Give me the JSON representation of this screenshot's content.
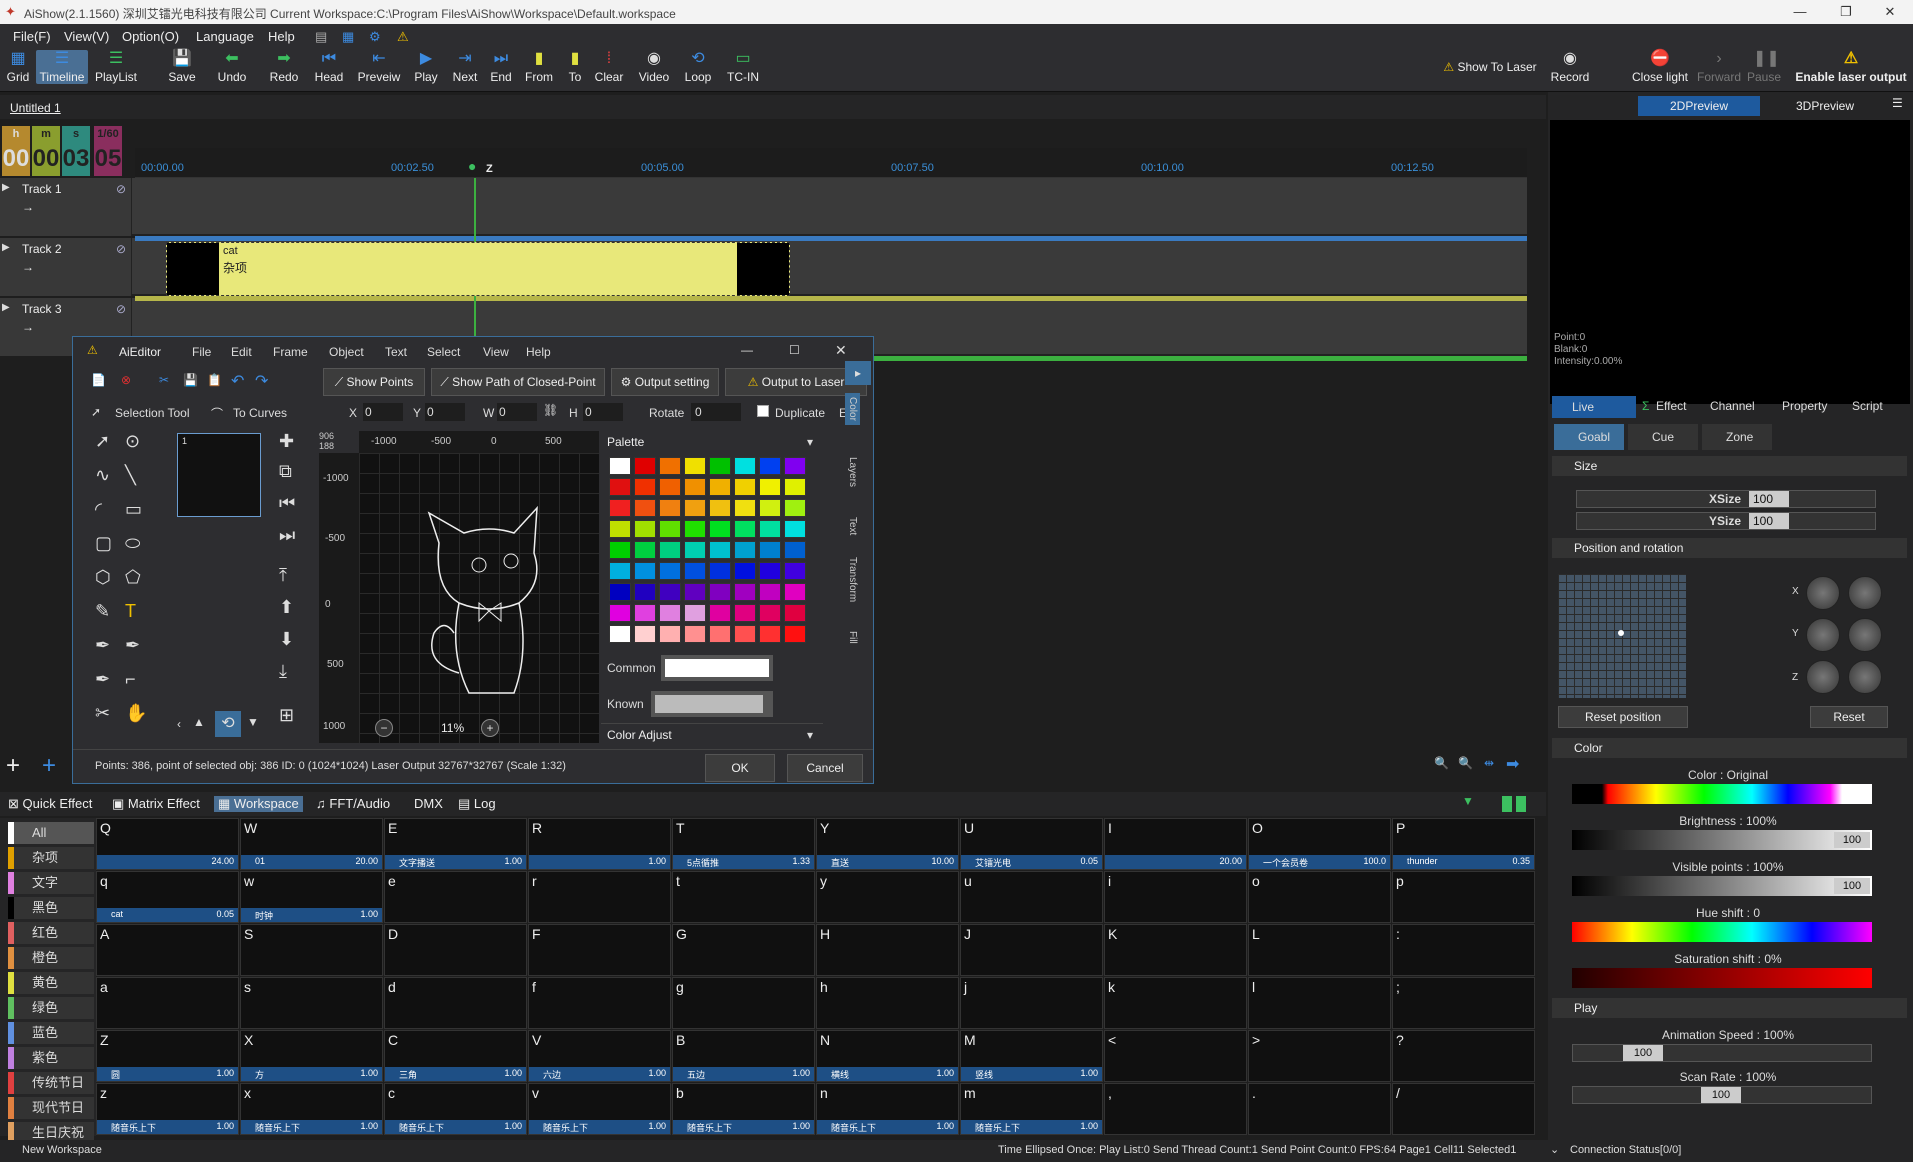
{
  "window": {
    "title": "AiShow(2.1.1560) 深圳艾镭光电科技有限公司 Current Workspace:C:\\Program Files\\AiShow\\Workspace\\Default.workspace"
  },
  "menu": [
    "File(F)",
    "View(V)",
    "Option(O)",
    "Language",
    "Help"
  ],
  "toolbar": [
    "Grid",
    "Timeline",
    "PlayList",
    "Save",
    "Undo",
    "Redo",
    "Head",
    "Preveiw",
    "Play",
    "Next",
    "End",
    "From",
    "To",
    "Clear",
    "Video",
    "Loop",
    "TC-IN"
  ],
  "show_to_laser": "Show To Laser",
  "right_toolbar": [
    "Record",
    "Close light",
    "Forward",
    "Pause",
    "Enable laser output"
  ],
  "preview_tabs": [
    "2DPreview",
    "3DPreview"
  ],
  "preview_info": [
    "Point:0",
    "Blank:0",
    "Intensity:0.00%"
  ],
  "doc_tab": "Untitled 1",
  "hms": [
    {
      "a": "h",
      "b": "00"
    },
    {
      "a": "m",
      "b": "00"
    },
    {
      "a": "s",
      "b": "03"
    },
    {
      "a": "1/60",
      "b": "05"
    }
  ],
  "ruler_ticks": [
    "00:00.00",
    "00:02.50",
    "00:05.00",
    "00:07.50",
    "00:10.00",
    "00:12.50"
  ],
  "playhead_label": "Z",
  "tracks": [
    "Track 1",
    "Track 2",
    "Track 3"
  ],
  "track_arrow": "→",
  "clip": {
    "name": "cat",
    "sub": "杂项"
  },
  "editor": {
    "title": "AiEditor",
    "menu": [
      "File",
      "Edit",
      "Frame",
      "Object",
      "Text",
      "Select",
      "View",
      "Help"
    ],
    "buttons": [
      "Show Points",
      "Show Path of Closed-Point",
      "Output setting",
      "Output to Laser"
    ],
    "tool_row": {
      "selection": "Selection Tool",
      "curves": "To Curves",
      "x_label": "X",
      "x_val": "0",
      "y_label": "Y",
      "y_val": "0",
      "w_label": "W",
      "w_val": "0",
      "h_label": "H",
      "h_val": "0",
      "rotate_label": "Rotate",
      "rotate_val": "0",
      "duplicate": "Duplicate",
      "exp": "Exp"
    },
    "coords": [
      "906",
      "188"
    ],
    "hruler": [
      "-1000",
      "-500",
      "0",
      "500"
    ],
    "vruler": [
      "-1000",
      "-500",
      "0",
      "500",
      "1000"
    ],
    "zoom": "11%",
    "frame_no": "1",
    "palette_title": "Palette",
    "common": "Common",
    "known": "Known",
    "color_adjust": "Color Adjust",
    "side_tabs": [
      "Color",
      "Layers",
      "Text",
      "Transform",
      "Fill"
    ],
    "status": "Points: 386, point of selected obj: 386 ID: 0 (1024*1024) Laser Output 32767*32767 (Scale 1:32)",
    "ok": "OK",
    "cancel": "Cancel"
  },
  "palette_colors": [
    [
      "#ffffff",
      "#e00000",
      "#f07000",
      "#f0e000",
      "#00c000",
      "#00e0e0",
      "#0040f0",
      "#8000f0"
    ],
    [
      "#e01010",
      "#f03000",
      "#f06000",
      "#f09000",
      "#f0b000",
      "#f0d000",
      "#f0f000",
      "#e0f000"
    ],
    [
      "#f02020",
      "#f05010",
      "#f08010",
      "#f0a010",
      "#f0c010",
      "#f0e010",
      "#d0f010",
      "#a0f010"
    ],
    [
      "#c0e000",
      "#a0e000",
      "#60e000",
      "#20e000",
      "#00e020",
      "#00e060",
      "#00e0a0",
      "#00e0e0"
    ],
    [
      "#00d000",
      "#00d040",
      "#00d080",
      "#00d0b0",
      "#00c0d0",
      "#00a0d0",
      "#0080d0",
      "#0060d0"
    ],
    [
      "#00b0e0",
      "#0090e0",
      "#0070e0",
      "#0050e0",
      "#0030e0",
      "#0010e0",
      "#2000e0",
      "#4000e0"
    ],
    [
      "#0000c0",
      "#2000c0",
      "#4000c0",
      "#6000c0",
      "#8000c0",
      "#a000c0",
      "#c000c0",
      "#e000c0"
    ],
    [
      "#e000e0",
      "#e040e0",
      "#e080e0",
      "#e0a0e0",
      "#e000a0",
      "#e00080",
      "#e00060",
      "#e00040"
    ],
    [
      "#ffffff",
      "#ffd0d0",
      "#ffb0b0",
      "#ff9090",
      "#ff7070",
      "#ff5050",
      "#ff3030",
      "#ff1010"
    ]
  ],
  "bottom_tabs": [
    "Quick Effect",
    "Matrix Effect",
    "Workspace",
    "FFT/Audio",
    "DMX",
    "Log"
  ],
  "categories": [
    {
      "label": "All",
      "color": "#ffffff"
    },
    {
      "label": "杂项",
      "color": "#e0a000"
    },
    {
      "label": "文字",
      "color": "#e080e0"
    },
    {
      "label": "黑色",
      "color": "#000000"
    },
    {
      "label": "红色",
      "color": "#e06060"
    },
    {
      "label": "橙色",
      "color": "#e09040"
    },
    {
      "label": "黄色",
      "color": "#e0e040"
    },
    {
      "label": "绿色",
      "color": "#60c060"
    },
    {
      "label": "蓝色",
      "color": "#6090e0"
    },
    {
      "label": "紫色",
      "color": "#c080e0"
    },
    {
      "label": "传统节日",
      "color": "#e04040"
    },
    {
      "label": "现代节日",
      "color": "#e08040"
    },
    {
      "label": "生日庆祝",
      "color": "#e0a060"
    }
  ],
  "grid_rows": [
    [
      {
        "k": "Q",
        "n": "",
        "v": "24.00"
      },
      {
        "k": "W",
        "n": "01",
        "v": "20.00"
      },
      {
        "k": "E",
        "n": "文字播送",
        "v": "1.00"
      },
      {
        "k": "R",
        "n": "",
        "v": "1.00"
      },
      {
        "k": "T",
        "n": "5点循推",
        "v": "1.33"
      },
      {
        "k": "Y",
        "n": "直送",
        "v": "10.00"
      },
      {
        "k": "U",
        "n": "艾镭光电",
        "v": "0.05"
      },
      {
        "k": "I",
        "n": "",
        "v": "20.00"
      },
      {
        "k": "O",
        "n": "一个会员卷",
        "v": "100.0"
      },
      {
        "k": "P",
        "n": "thunder",
        "v": "0.35"
      }
    ],
    [
      {
        "k": "q",
        "n": "cat",
        "v": "0.05"
      },
      {
        "k": "w",
        "n": "时钟",
        "v": "1.00"
      },
      {
        "k": "e"
      },
      {
        "k": "r"
      },
      {
        "k": "t"
      },
      {
        "k": "y"
      },
      {
        "k": "u"
      },
      {
        "k": "i"
      },
      {
        "k": "o"
      },
      {
        "k": "p"
      }
    ],
    [
      {
        "k": "A"
      },
      {
        "k": "S"
      },
      {
        "k": "D"
      },
      {
        "k": "F"
      },
      {
        "k": "G"
      },
      {
        "k": "H"
      },
      {
        "k": "J"
      },
      {
        "k": "K"
      },
      {
        "k": "L"
      },
      {
        "k": ":"
      }
    ],
    [
      {
        "k": "a"
      },
      {
        "k": "s"
      },
      {
        "k": "d"
      },
      {
        "k": "f"
      },
      {
        "k": "g"
      },
      {
        "k": "h"
      },
      {
        "k": "j"
      },
      {
        "k": "k"
      },
      {
        "k": "l"
      },
      {
        "k": ";"
      }
    ],
    [
      {
        "k": "Z",
        "n": "圆",
        "v": "1.00"
      },
      {
        "k": "X",
        "n": "方",
        "v": "1.00"
      },
      {
        "k": "C",
        "n": "三角",
        "v": "1.00"
      },
      {
        "k": "V",
        "n": "六边",
        "v": "1.00"
      },
      {
        "k": "B",
        "n": "五边",
        "v": "1.00"
      },
      {
        "k": "N",
        "n": "横线",
        "v": "1.00"
      },
      {
        "k": "M",
        "n": "竖线",
        "v": "1.00"
      },
      {
        "k": "<"
      },
      {
        "k": ">"
      },
      {
        "k": "?"
      }
    ],
    [
      {
        "k": "z",
        "n": "随音乐上下",
        "v": "1.00"
      },
      {
        "k": "x",
        "n": "随音乐上下",
        "v": "1.00"
      },
      {
        "k": "c",
        "n": "随音乐上下",
        "v": "1.00"
      },
      {
        "k": "v",
        "n": "随音乐上下",
        "v": "1.00"
      },
      {
        "k": "b",
        "n": "随音乐上下",
        "v": "1.00"
      },
      {
        "k": "n",
        "n": "随音乐上下",
        "v": "1.00"
      },
      {
        "k": "m",
        "n": "随音乐上下",
        "v": "1.00"
      },
      {
        "k": ","
      },
      {
        "k": "."
      },
      {
        "k": "/"
      }
    ]
  ],
  "right": {
    "tabs": [
      "Live Control",
      "Effect",
      "Channel",
      "Property",
      "Script"
    ],
    "subtabs": [
      "Goabl",
      "Cue",
      "Zone"
    ],
    "size_title": "Size",
    "xsize_label": "XSize",
    "xsize": "100",
    "ysize_label": "YSize",
    "ysize": "100",
    "pos_title": "Position and rotation",
    "axes": [
      "X",
      "Y",
      "Z"
    ],
    "reset_position": "Reset position",
    "reset": "Reset",
    "color_title": "Color",
    "color_label": "Color : Original",
    "brightness_label": "Brightness : 100%",
    "brightness": "100",
    "visible_label": "Visible points : 100%",
    "visible": "100",
    "hue_label": "Hue shift : 0",
    "sat_label": "Saturation shift : 0%",
    "play_title": "Play",
    "anim_label": "Animation Speed : 100%",
    "anim": "100",
    "scan_label": "Scan Rate : 100%",
    "scan": "100",
    "connection": "Connection Status[0/0]"
  },
  "status": {
    "left": "New Workspace",
    "right": "Time Ellipsed Once: Play List:0 Send Thread Count:1 Send Point Count:0 FPS:64  Page1 Cell11 Selected1"
  }
}
